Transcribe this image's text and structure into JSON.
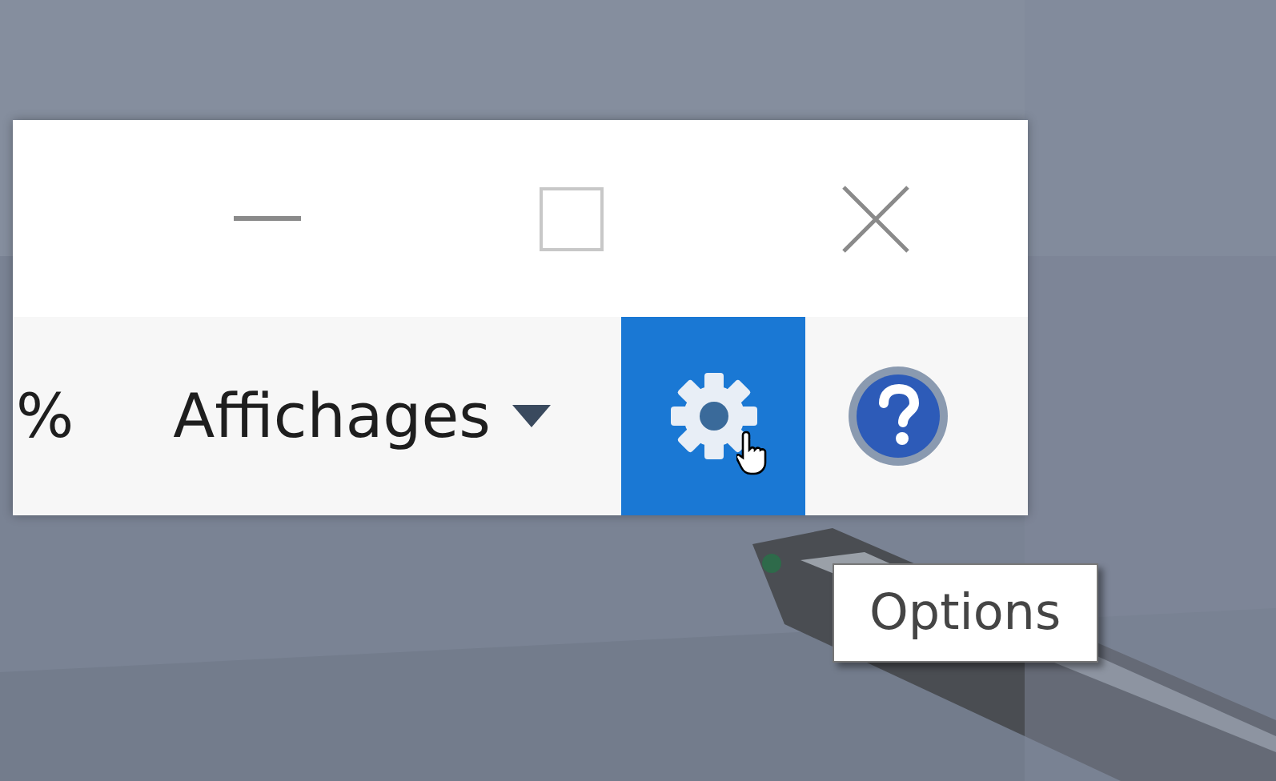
{
  "toolbar": {
    "zoom_fragment": "%",
    "view_menu": {
      "label": "Affichages"
    },
    "buttons": [
      {
        "kind": "settings",
        "hovered": true
      },
      {
        "kind": "help",
        "hovered": false
      }
    ]
  },
  "tooltip": {
    "text": "Options"
  }
}
